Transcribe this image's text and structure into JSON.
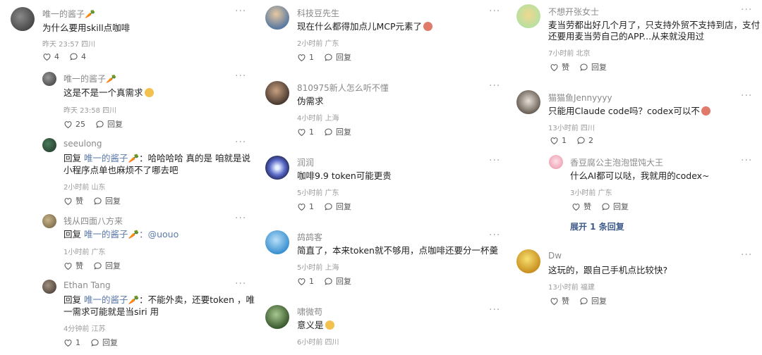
{
  "comments": {
    "c1": {
      "name": "唯一的酱子🥕",
      "text": "为什么要用skill点咖啡",
      "meta": "昨天 23:57 四川",
      "likes": "4",
      "replies": "4"
    },
    "c2": {
      "name": "唯一的酱子🥕",
      "text": "这是不是一个真需求",
      "meta": "昨天 23:58 四川",
      "likes": "25",
      "reply_label": "回复"
    },
    "c3": {
      "name": "seeulong",
      "reply_prefix": "回复",
      "reply_to": "唯一的酱子🥕",
      "text1": "：哈哈哈哈 真的是 咱就是说",
      "text2": "小程序点单也麻烦不了哪去吧",
      "meta": "2小时前 山东",
      "like_label": "赞",
      "reply_label": "回复"
    },
    "c4": {
      "name": "钱从四面八方来",
      "reply_prefix": "回复",
      "reply_to": "唯一的酱子🥕",
      "text1": "：@uouo",
      "meta": "1小时前 广东",
      "like_label": "赞",
      "reply_label": "回复"
    },
    "c5": {
      "name": "Ethan Tang",
      "reply_prefix": "回复",
      "reply_to": "唯一的酱子🥕",
      "text1": "：不能外卖，还要token ，唯",
      "text2": "一需求可能就是当siri 用",
      "meta": "4分钟前 江苏",
      "likes": "1",
      "reply_label": "回复"
    },
    "c6": {
      "name": "科技豆先生",
      "text": "现在什么都得加点儿MCP元素了",
      "meta": "2小时前 广东",
      "likes": "1",
      "reply_label": "回复"
    },
    "c7": {
      "name": "810975新人怎么听不懂",
      "text": "伪需求",
      "meta": "4小时前 上海",
      "likes": "1",
      "reply_label": "回复"
    },
    "c8": {
      "name": "润润",
      "text": "咖啡9.9 token可能更贵",
      "meta": "5小时前 广东",
      "likes": "1",
      "reply_label": "回复"
    },
    "c9": {
      "name": "鸪鸪客",
      "text": "简直了，本来token就不够用，点咖啡还要分一杯羹",
      "meta": "5小时前 上海",
      "likes": "1",
      "reply_label": "回复"
    },
    "c10": {
      "name": "啸微苟",
      "text": "意义是",
      "meta": "6小时前 四川"
    },
    "c11": {
      "name": "不想开张女士",
      "text1": "麦当劳都出好几个月了，只支持外贸不支持到店，支付",
      "text2": "还要用麦当劳自己的APP...从来就没用过",
      "meta": "7小时前 北京",
      "like_label": "赞",
      "reply_label": "回复"
    },
    "c12": {
      "name": "猫猫鱼Jennyyyy",
      "text": "只能用Claude code吗？codex可以不",
      "meta": "13小时前 四川",
      "likes": "1",
      "replies": "2"
    },
    "c13": {
      "name": "香豆腐公主泡泡馄饨大王",
      "text": "什么AI都可以哒，我就用的codex~",
      "meta": "3小时前 广东",
      "like_label": "赞",
      "reply_label": "回复"
    },
    "expand_label": "展开 1 条回复",
    "c14": {
      "name": "Dw",
      "text": "这玩的，跟自己手机点比较快?",
      "meta": "13小时前 福建",
      "like_label": "赞",
      "reply_label": "回复"
    }
  },
  "more_label": "···",
  "colors": {
    "accent": "#3d5a8a",
    "meta": "#9a9a9a",
    "name": "#8a8a8a"
  }
}
